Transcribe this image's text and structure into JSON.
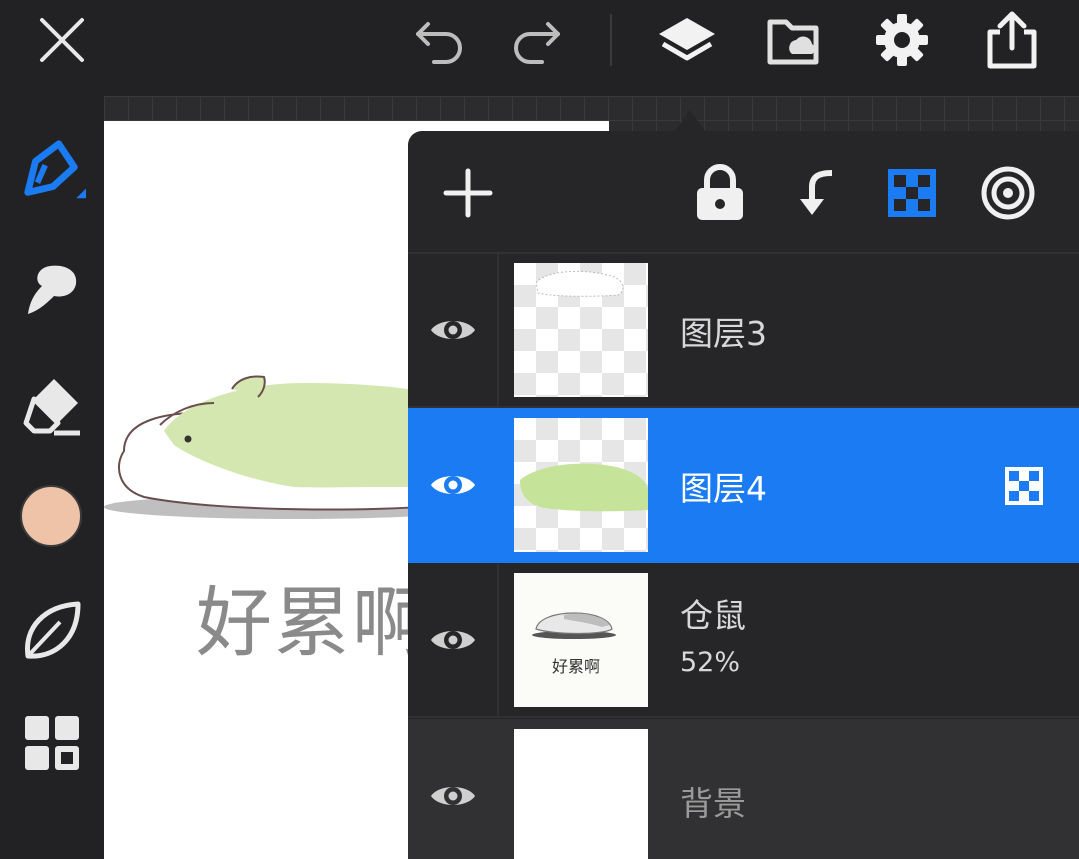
{
  "toolbar": {
    "icons": [
      "close-icon",
      "undo-icon",
      "redo-icon",
      "layers-icon",
      "folder-cloud-icon",
      "gear-icon",
      "share-icon"
    ]
  },
  "tools": {
    "icons": [
      "pen-icon",
      "smudge-icon",
      "eraser-icon",
      "color-swatch",
      "leaf-icon",
      "gallery-icon"
    ],
    "current_color": "#eec3a8"
  },
  "canvas": {
    "caption": "好累啊"
  },
  "layers_panel": {
    "actions": [
      "add-icon",
      "lock-icon",
      "merge-down-icon",
      "alpha-lock-icon",
      "reference-icon"
    ],
    "accent_color": "#1a7bf2",
    "layers": [
      {
        "name": "图层3",
        "visible": true,
        "selected": false
      },
      {
        "name": "图层4",
        "visible": true,
        "selected": true,
        "alpha_locked": true
      },
      {
        "name": "仓鼠",
        "opacity": "52%",
        "visible": true,
        "selected": false,
        "thumb_caption": "好累啊"
      },
      {
        "name": "背景",
        "visible": true,
        "selected": false,
        "background": true
      }
    ]
  }
}
